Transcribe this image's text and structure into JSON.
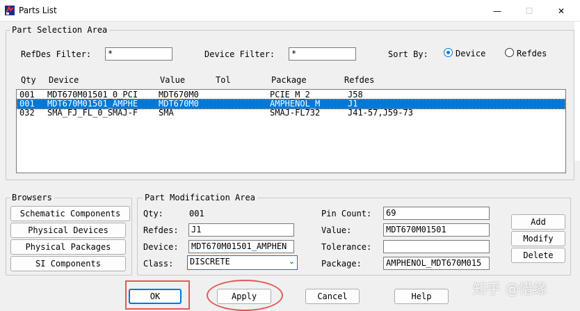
{
  "window": {
    "title": "Parts List",
    "buttons": {
      "minimize": "—",
      "maximize": "☐",
      "close": "✕"
    }
  },
  "selection": {
    "group_title": "Part Selection Area",
    "refdes_filter_label": "RefDes Filter:",
    "refdes_filter_value": "*",
    "device_filter_label": "Device Filter:",
    "device_filter_value": "*",
    "sort_by_label": "Sort By:",
    "sort_options": [
      {
        "label": "Device",
        "selected": true
      },
      {
        "label": "Refdes",
        "selected": false
      }
    ]
  },
  "parts_table": {
    "columns": [
      "Qty",
      "Device",
      "Value",
      "Tol",
      "Package",
      "Refdes"
    ],
    "rows": [
      {
        "qty": "001",
        "device": "MDT670M01501_0_PCI",
        "value": "MDT670M0",
        "tol": "",
        "package": "PCIE_M_2",
        "refdes": "J58",
        "selected": false
      },
      {
        "qty": "001",
        "device": "MDT670M01501_AMPHE",
        "value": "MDT670M0",
        "tol": "",
        "package": "AMPHENOL_M",
        "refdes": "J1",
        "selected": true
      },
      {
        "qty": "032",
        "device": "SMA_FJ_FL_0_SMAJ-F",
        "value": "SMA",
        "tol": "",
        "package": "SMAJ-FL732",
        "refdes": "J41-57,J59-73",
        "selected": false
      }
    ]
  },
  "browsers": {
    "group_title": "Browsers",
    "buttons": [
      "Schematic Components",
      "Physical Devices",
      "Physical Packages",
      "SI Components"
    ]
  },
  "modification": {
    "group_title": "Part Modification Area",
    "qty_label": "Qty:",
    "qty_value": "001",
    "refdes_label": "Refdes:",
    "refdes_value": "J1",
    "device_label": "Device:",
    "device_value": "MDT670M01501_AMPHEN",
    "class_label": "Class:",
    "class_value": "DISCRETE",
    "pin_count_label": "Pin Count:",
    "pin_count_value": "69",
    "value_label": "Value:",
    "value_value": "MDT670M01501",
    "tolerance_label": "Tolerance:",
    "tolerance_value": "",
    "package_label": "Package:",
    "package_value": "AMPHENOL_MDT670M015",
    "buttons": {
      "add": "Add",
      "modify": "Modify",
      "delete": "Delete"
    }
  },
  "footer": {
    "ok": "OK",
    "apply": "Apply",
    "cancel": "Cancel",
    "help": "Help"
  },
  "watermark": "知乎 @惜缘",
  "colors": {
    "selection": "#0078d7",
    "annotation": "#e05a5a"
  }
}
